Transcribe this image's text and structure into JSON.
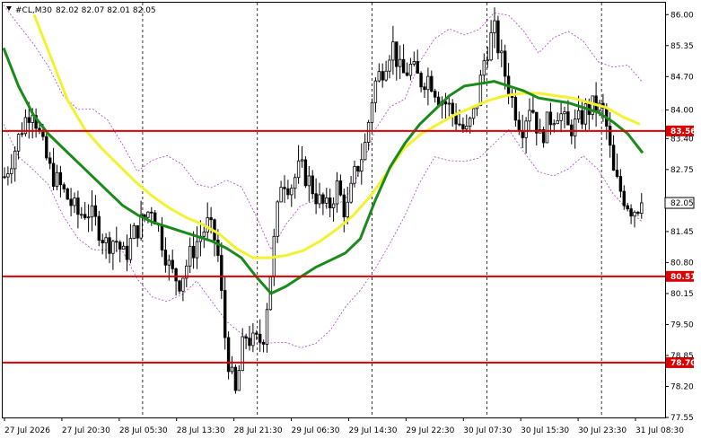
{
  "header": {
    "symbol": "#CL,M30",
    "ohlc": "82.02 82.07 82.01 82.05"
  },
  "colors": {
    "background": "#ffffff",
    "candle": "#000000",
    "grid": "#000000",
    "ma_fast": "#1a8a1a",
    "ma_slow": "#f2f230",
    "envelope": "#b040c8",
    "level": "#dd0000"
  },
  "chart_data": {
    "type": "candlestick",
    "title": "",
    "xlabel": "",
    "ylabel": "",
    "ylim": [
      77.55,
      86.25
    ],
    "y_ticks": [
      86.0,
      85.35,
      84.7,
      84.0,
      83.4,
      82.75,
      82.05,
      81.45,
      80.8,
      80.15,
      79.5,
      78.85,
      78.2,
      77.55
    ],
    "x_ticks": [
      "27 Jul 2026",
      "27 Jul 20:30",
      "28 Jul 05:30",
      "28 Jul 13:30",
      "28 Jul 21:30",
      "29 Jul 06:30",
      "29 Jul 14:30",
      "29 Jul 22:30",
      "30 Jul 07:30",
      "30 Jul 15:30",
      "30 Jul 23:30",
      "31 Jul 08:30"
    ],
    "vertical_grid_at": [
      "27 Jul 20:30",
      "28 Jul 13:30",
      "29 Jul 06:30",
      "29 Jul 22:30",
      "30 Jul 15:30",
      "31 Jul 08:30"
    ],
    "last_price": 82.05,
    "levels": [
      83.56,
      80.51,
      78.7
    ],
    "close_path": [
      82.6,
      83.1,
      83.7,
      84.1,
      83.3,
      82.7,
      82.4,
      82.1,
      81.8,
      81.9,
      81.6,
      81.2,
      81.3,
      80.9,
      81.4,
      81.7,
      82.0,
      81.3,
      80.6,
      80.4,
      80.9,
      81.3,
      81.6,
      81.2,
      79.0,
      78.0,
      79.3,
      79.1,
      79.2,
      80.9,
      82.6,
      82.4,
      82.8,
      82.5,
      82.1,
      81.9,
      82.4,
      81.8,
      82.7,
      83.2,
      84.5,
      84.9,
      85.4,
      84.7,
      84.9,
      84.6,
      84.7,
      84.3,
      84.1,
      83.8,
      83.5,
      84.0,
      85.1,
      85.7,
      84.9,
      84.2,
      83.6,
      84.2,
      83.4,
      83.8,
      84.0,
      83.6,
      83.7,
      84.0,
      84.1,
      83.9,
      82.6,
      82.2,
      81.9,
      82.05
    ],
    "series": [
      {
        "name": "",
        "values": [
          85.3,
          84.5,
          83.9,
          83.5,
          83.2,
          82.9,
          82.6,
          82.3,
          82.0,
          81.8,
          81.65,
          81.55,
          81.45,
          81.35,
          81.25,
          81.1,
          80.9,
          80.5,
          80.15,
          80.3,
          80.5,
          80.7,
          80.85,
          81.0,
          81.3,
          82.1,
          82.8,
          83.3,
          83.7,
          84.0,
          84.3,
          84.5,
          84.55,
          84.6,
          84.5,
          84.4,
          84.25,
          84.2,
          84.15,
          84.05,
          83.95,
          83.75,
          83.5,
          83.1
        ]
      },
      {
        "name": "",
        "values": [
          86.0,
          85.1,
          84.2,
          83.6,
          83.2,
          82.85,
          82.5,
          82.2,
          81.95,
          81.75,
          81.6,
          81.4,
          81.1,
          80.9,
          80.9,
          80.95,
          81.05,
          81.25,
          81.5,
          81.8,
          82.2,
          82.7,
          83.2,
          83.5,
          83.7,
          83.9,
          84.05,
          84.2,
          84.3,
          84.35,
          84.35,
          84.3,
          84.25,
          84.15,
          84.05,
          83.85,
          83.7
        ]
      }
    ]
  }
}
